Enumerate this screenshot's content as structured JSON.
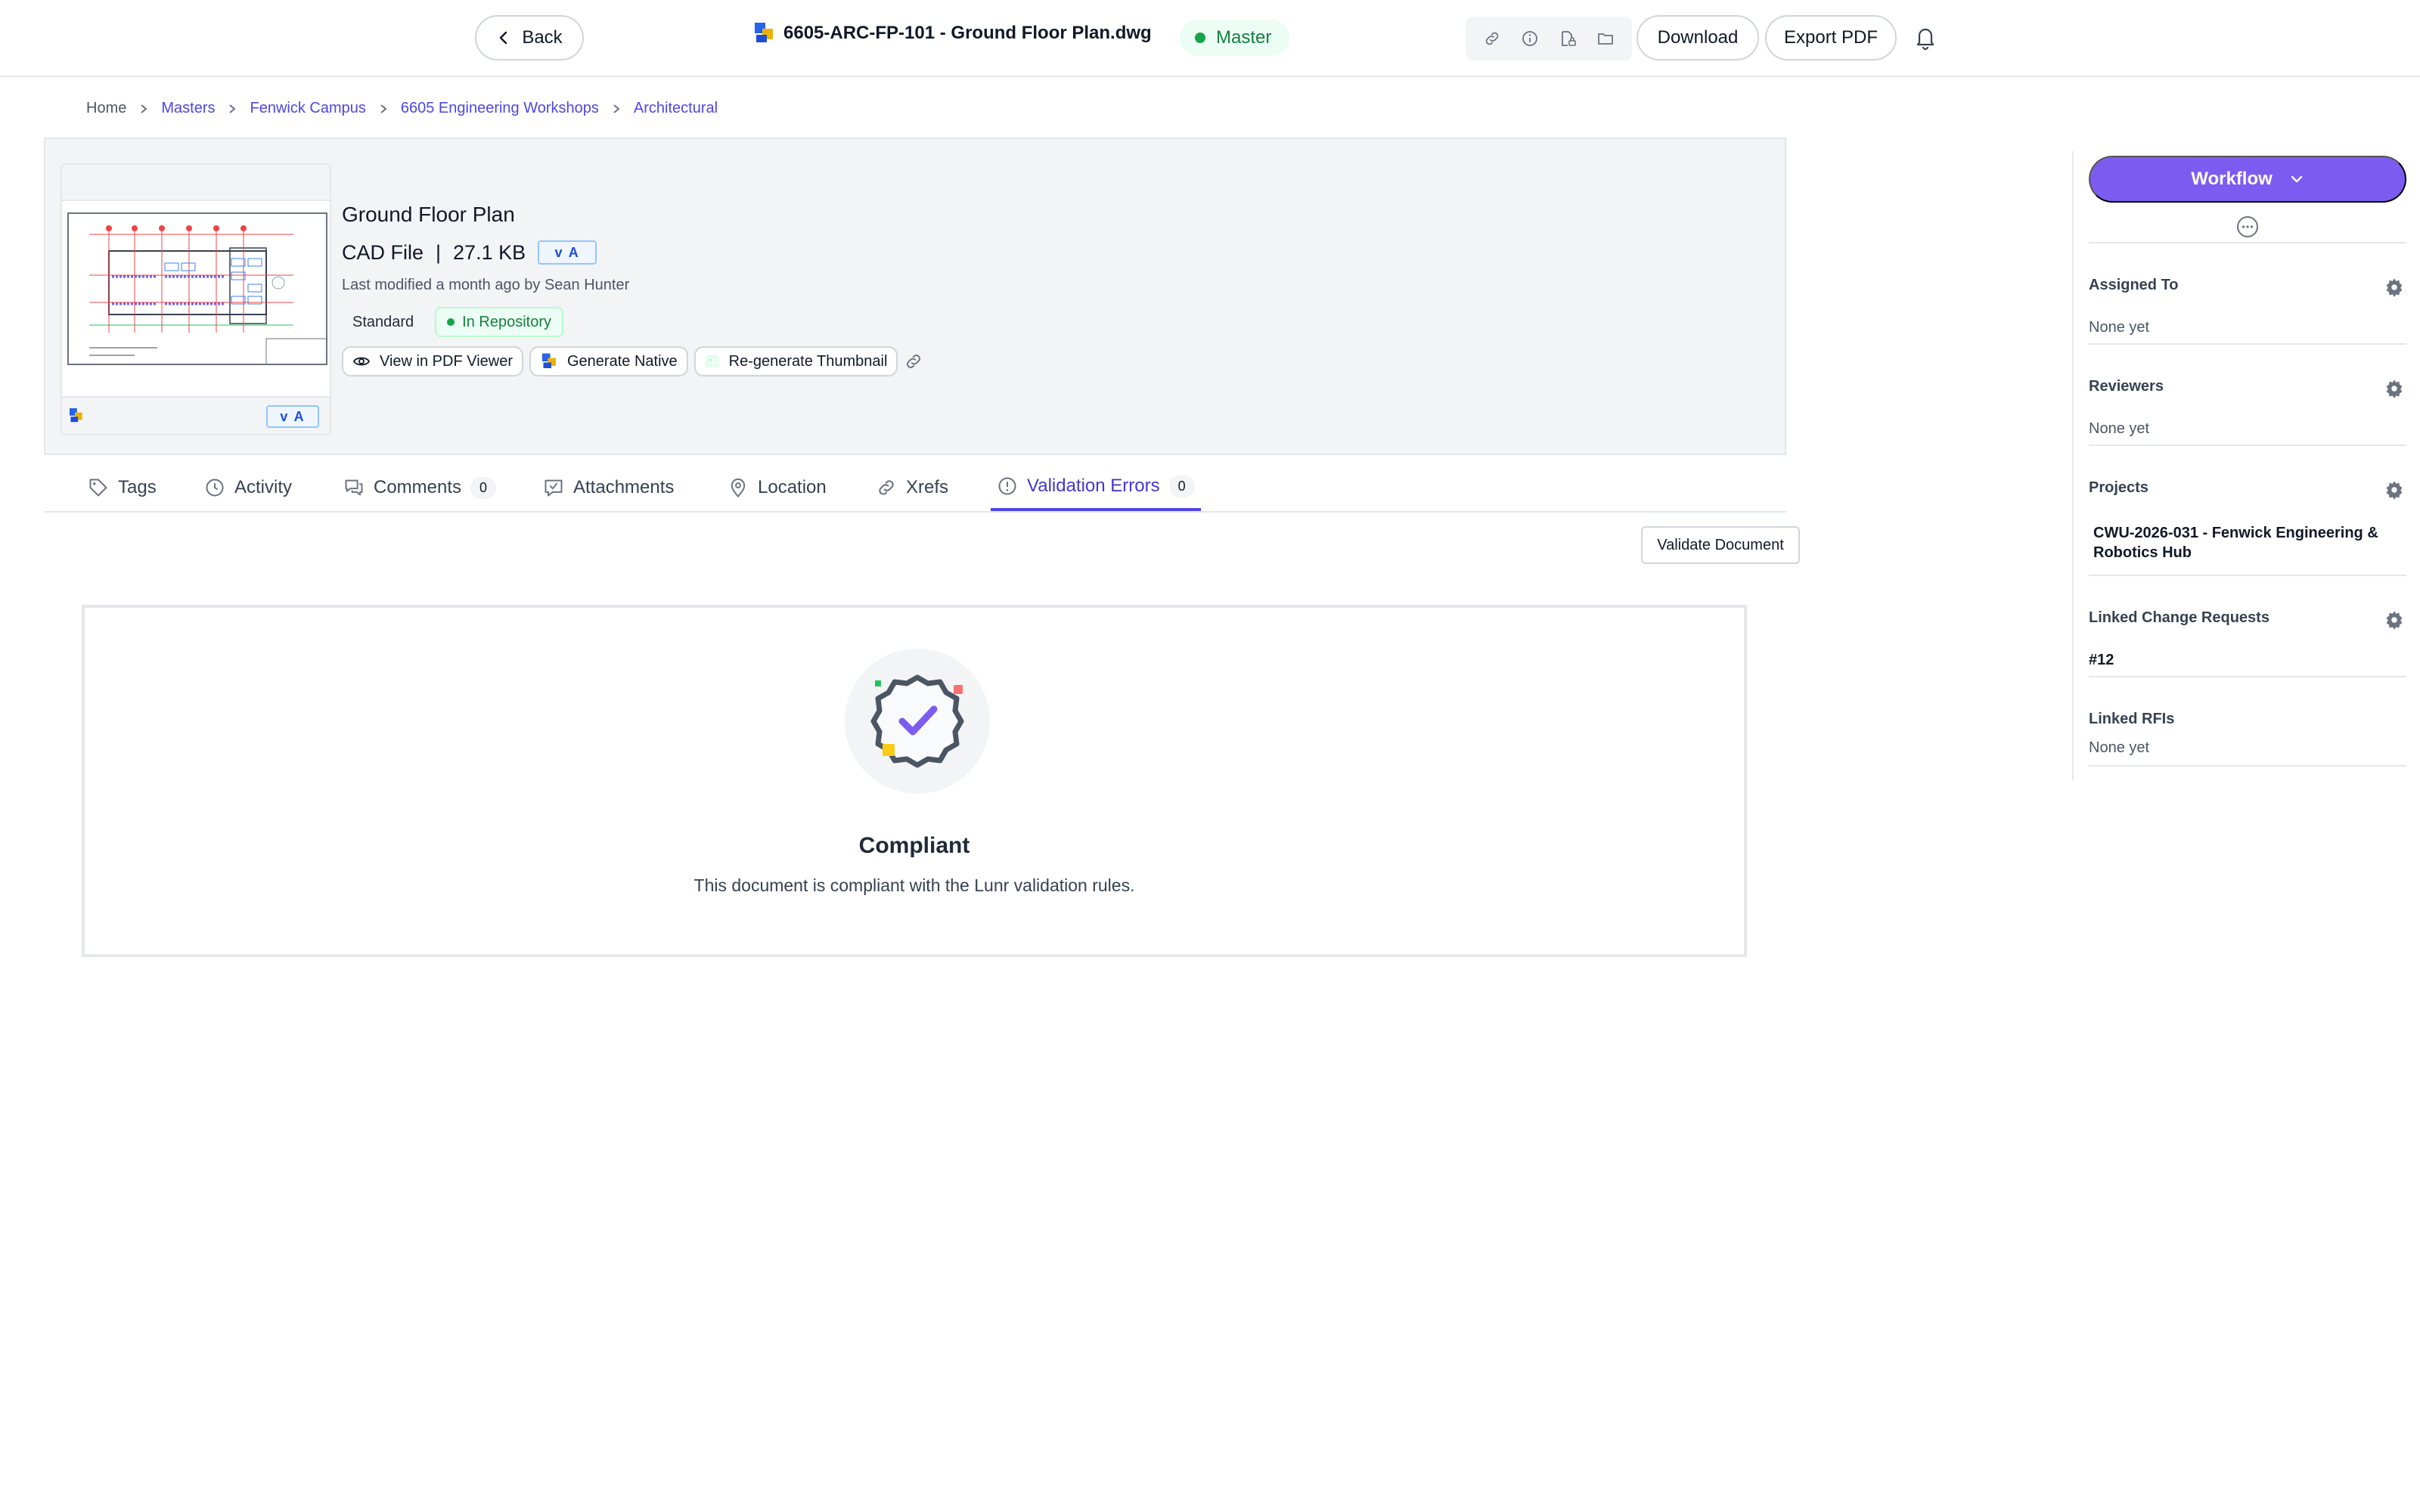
{
  "topbar": {
    "back_label": "Back",
    "file_name": "6605-ARC-FP-101 - Ground Floor Plan.dwg",
    "status_badge": "Master",
    "download_label": "Download",
    "export_label": "Export PDF",
    "icons": [
      "link-icon",
      "info-icon",
      "file-lock-icon",
      "folder-icon",
      "bell-icon"
    ]
  },
  "breadcrumb": [
    "Home",
    "Masters",
    "Fenwick Campus",
    "6605 Engineering Workshops",
    "Architectural"
  ],
  "document": {
    "name": "Ground Floor Plan",
    "type": "CAD File",
    "size": "27.1 KB",
    "version": "v A",
    "modified": "Last modified a month ago by Sean Hunter",
    "tags": {
      "standard": "Standard",
      "repository": "In Repository"
    },
    "actions": {
      "view_pdf": "View in PDF Viewer",
      "generate_native": "Generate Native",
      "regenerate_thumbnail": "Re-generate Thumbnail"
    }
  },
  "tabs": [
    {
      "label": "Tags"
    },
    {
      "label": "Activity"
    },
    {
      "label": "Comments",
      "count": "0"
    },
    {
      "label": "Attachments"
    },
    {
      "label": "Location"
    },
    {
      "label": "Xrefs"
    },
    {
      "label": "Validation Errors",
      "count": "0",
      "active": true
    }
  ],
  "validation": {
    "button_label": "Validate Document",
    "title": "Compliant",
    "description": "This document is compliant with the Lunr validation rules."
  },
  "sidebar": {
    "workflow_label": "Workflow",
    "sections": {
      "assigned": {
        "label": "Assigned To",
        "value": "None yet"
      },
      "reviewers": {
        "label": "Reviewers",
        "value": "None yet"
      },
      "projects": {
        "label": "Projects",
        "value_line1": "CWU-2026-031 - Fenwick Engineering &",
        "value_line2": "Robotics Hub"
      },
      "change_requests": {
        "label": "Linked Change Requests",
        "value": "#12"
      },
      "rfis": {
        "label": "Linked RFIs",
        "value": "None yet"
      }
    }
  },
  "colors": {
    "accent": "#4f46e5",
    "workflow": "#7c5cf0",
    "success": "#16a34a"
  }
}
